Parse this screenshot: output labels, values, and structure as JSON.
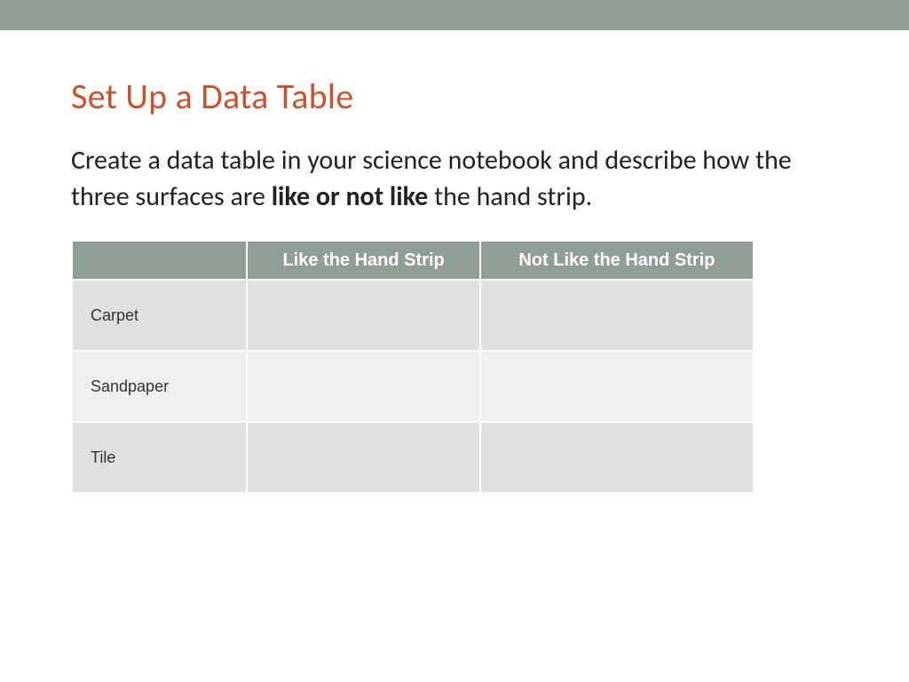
{
  "title": "Set Up a Data Table",
  "instruction": {
    "pre": "Create a data table in your science notebook and describe how the three surfaces are ",
    "bold": "like or not like",
    "post": " the hand strip."
  },
  "table": {
    "headers": {
      "blank": "",
      "col1": "Like the Hand Strip",
      "col2": "Not Like the Hand Strip"
    },
    "rows": [
      {
        "label": "Carpet",
        "c1": "",
        "c2": ""
      },
      {
        "label": "Sandpaper",
        "c1": "",
        "c2": ""
      },
      {
        "label": "Tile",
        "c1": "",
        "c2": ""
      }
    ]
  }
}
